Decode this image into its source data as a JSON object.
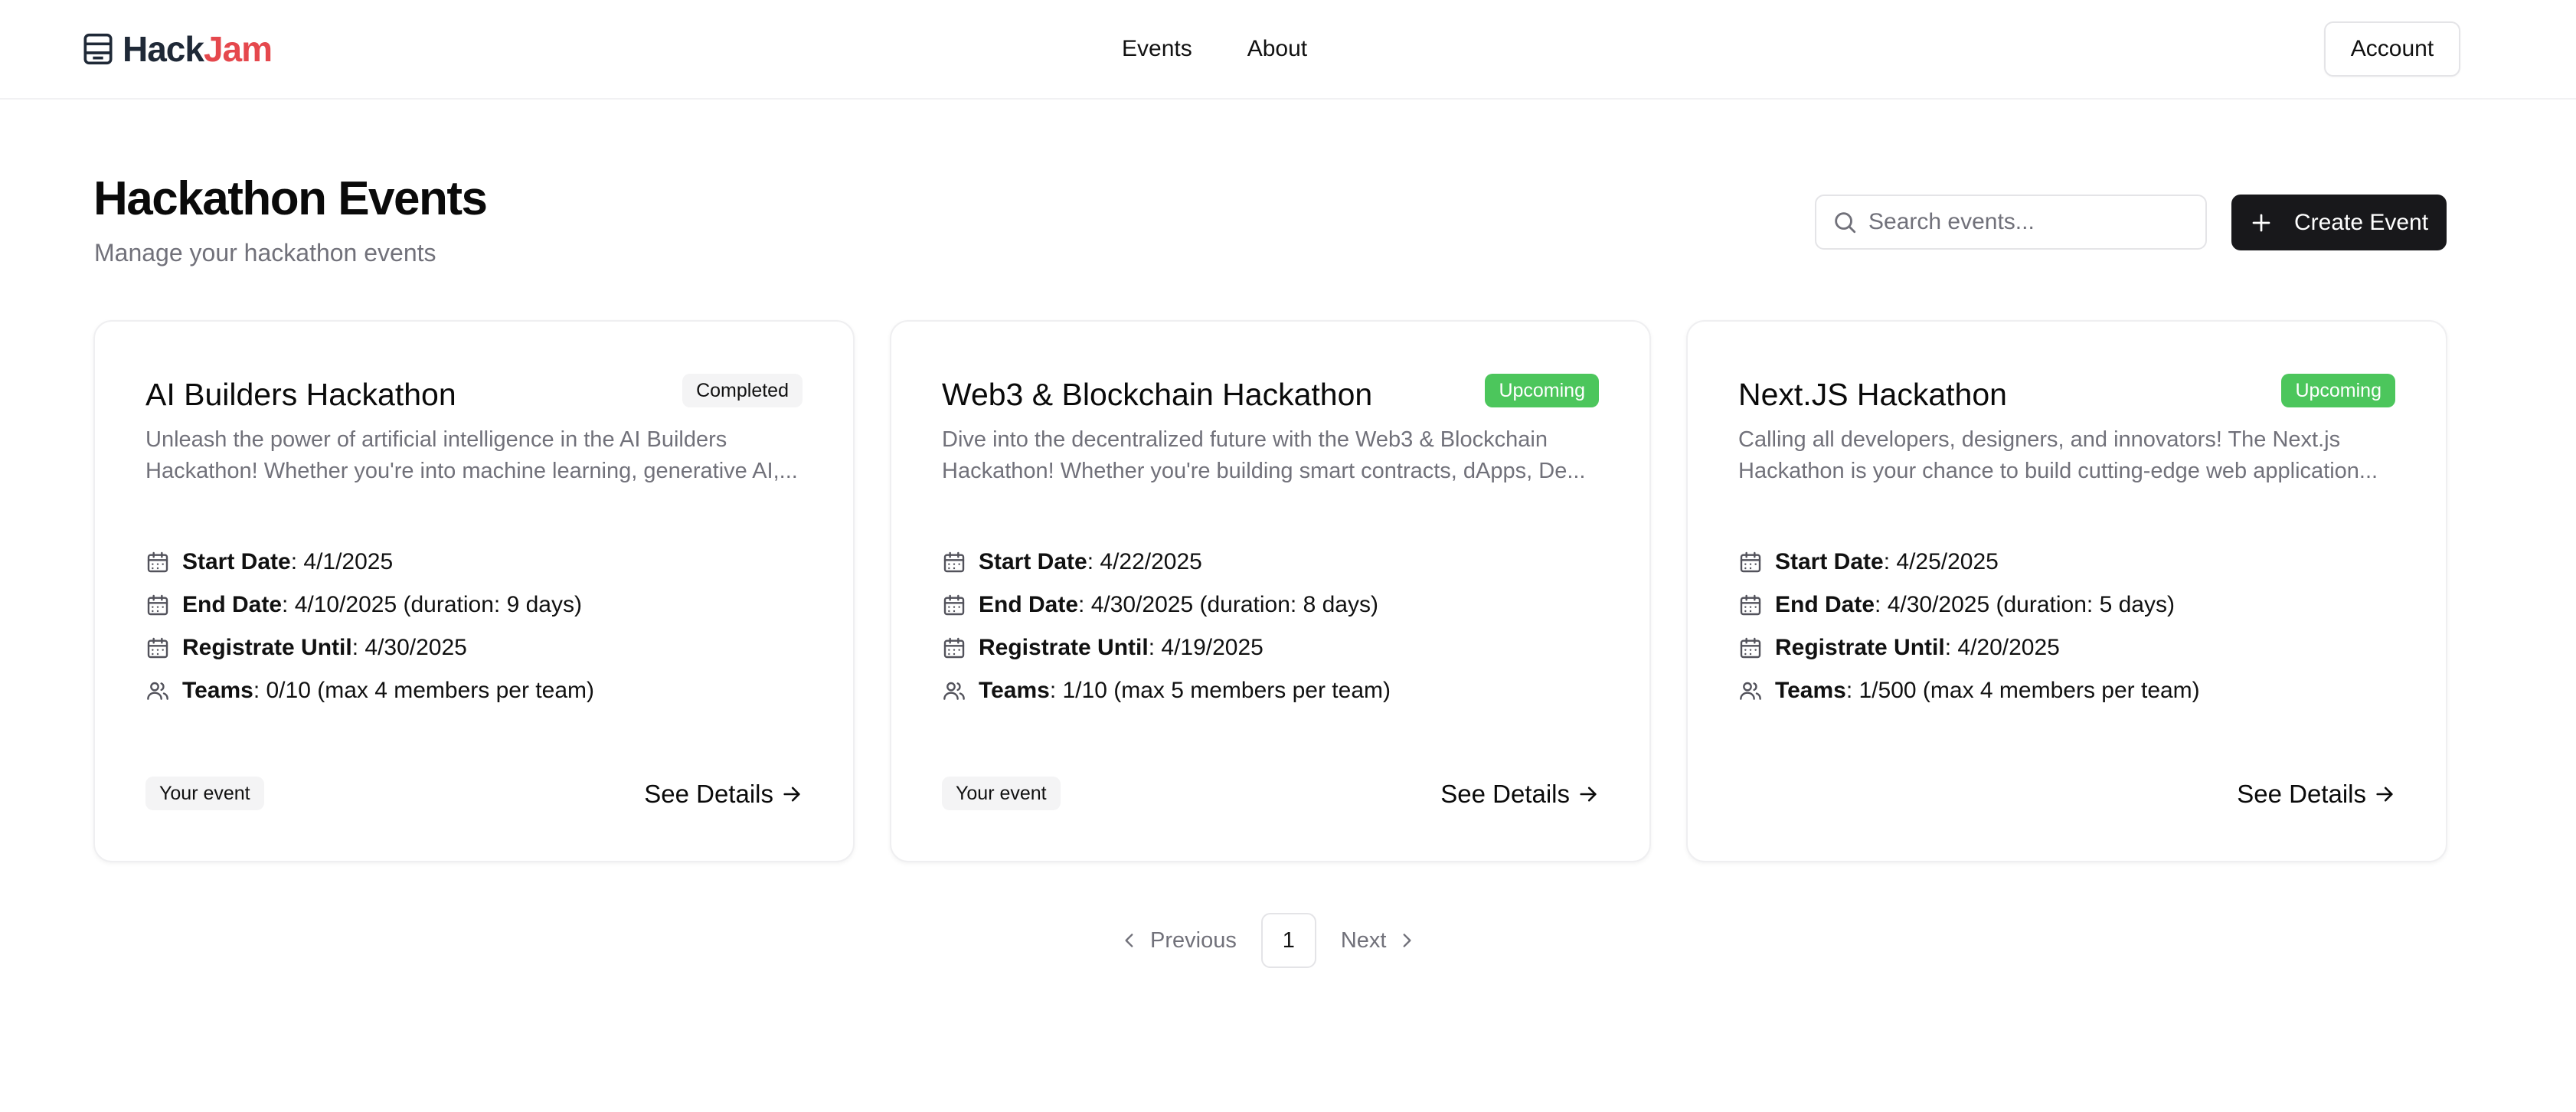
{
  "header": {
    "brand_part1": "Hack",
    "brand_part2": "Jam",
    "brand_icon": "database-stack-icon",
    "nav": [
      "Events",
      "About"
    ],
    "account_label": "Account"
  },
  "page": {
    "title": "Hackathon Events",
    "subtitle": "Manage your hackathon events",
    "search_placeholder": "Search events...",
    "create_label": "Create Event"
  },
  "cards": [
    {
      "title": "AI Builders Hackathon",
      "status": "Completed",
      "desc_line1": "Unleash the power of artificial intelligence in the AI Builders",
      "desc_line2": "Hackathon! Whether you're into machine learning, generative AI,...",
      "start_label": "Start Date",
      "start_value": ": 4/1/2025",
      "end_label": "End Date",
      "end_value": ": 4/10/2025 (duration: 9 days)",
      "reg_label": "Registrate Until",
      "reg_value": ": 4/30/2025",
      "teams_label": "Teams",
      "teams_value": ": 0/10 (max 4 members per team)",
      "tag": "Your event",
      "link": "See Details"
    },
    {
      "title": "Web3 & Blockchain Hackathon",
      "status": "Upcoming",
      "desc_line1": "Dive into the decentralized future with the Web3 & Blockchain",
      "desc_line2": "Hackathon! Whether you're building smart contracts, dApps, De...",
      "start_label": "Start Date",
      "start_value": ": 4/22/2025",
      "end_label": "End Date",
      "end_value": ": 4/30/2025 (duration: 8 days)",
      "reg_label": "Registrate Until",
      "reg_value": ": 4/19/2025",
      "teams_label": "Teams",
      "teams_value": ": 1/10 (max 5 members per team)",
      "tag": "Your event",
      "link": "See Details"
    },
    {
      "title": "Next.JS Hackathon",
      "status": "Upcoming",
      "desc_line1": "Calling all developers, designers, and innovators! The Next.js",
      "desc_line2": "Hackathon is your chance to build cutting-edge web application...",
      "start_label": "Start Date",
      "start_value": ": 4/25/2025",
      "end_label": "End Date",
      "end_value": ": 4/30/2025 (duration: 5 days)",
      "reg_label": "Registrate Until",
      "reg_value": ": 4/20/2025",
      "teams_label": "Teams",
      "teams_value": ": 1/500 (max 4 members per team)",
      "link": "See Details"
    }
  ],
  "pagination": {
    "prev_label": "Previous",
    "current_page": "1",
    "next_label": "Next"
  },
  "colors": {
    "brand_accent": "#e5484d",
    "upcoming_badge": "#4cc65c",
    "primary_button": "#18181b",
    "muted_text": "#71717a"
  }
}
